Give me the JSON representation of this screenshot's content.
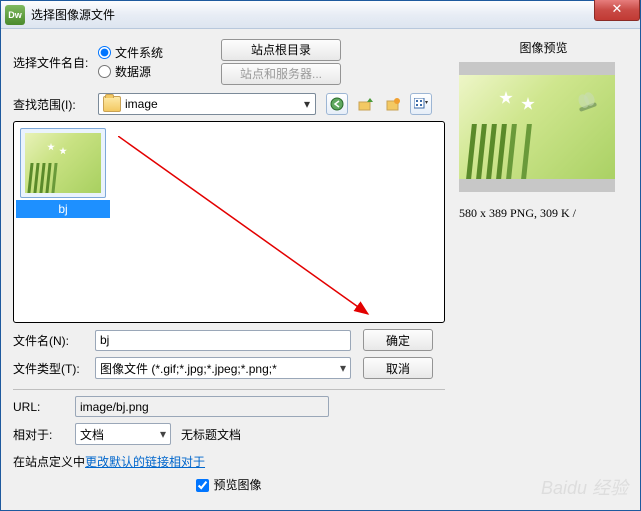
{
  "window": {
    "title": "选择图像源文件"
  },
  "source": {
    "label": "选择文件名自:",
    "option_fs": "文件系统",
    "option_db": "数据源",
    "btn_siteroot": "站点根目录",
    "btn_server": "站点和服务器..."
  },
  "lookin": {
    "label": "查找范围(I):",
    "folder": "image"
  },
  "file": {
    "name": "bj"
  },
  "filename": {
    "label": "文件名(N):",
    "value": "bj"
  },
  "filetype": {
    "label": "文件类型(T):",
    "value": "图像文件 (*.gif;*.jpg;*.jpeg;*.png;*"
  },
  "actions": {
    "ok": "确定",
    "cancel": "取消"
  },
  "url": {
    "label": "URL:",
    "value": "image/bj.png"
  },
  "relative": {
    "label": "相对于:",
    "value": "文档",
    "docname": "无标题文档"
  },
  "hint": {
    "prefix": "在站点定义中",
    "link": "更改默认的链接相对于"
  },
  "preview": {
    "title": "图像预览",
    "info": "580 x 389 PNG, 309 K /",
    "checkbox": "预览图像"
  },
  "watermark": "Baidu 经验"
}
